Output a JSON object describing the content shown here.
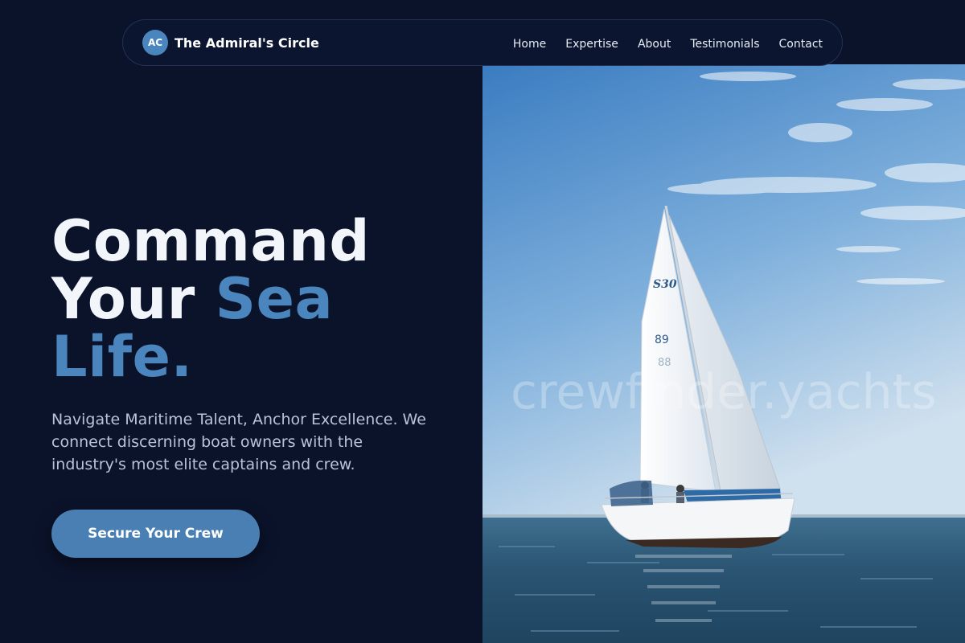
{
  "brand": {
    "initials": "AC",
    "name": "The Admiral's Circle"
  },
  "nav": {
    "items": [
      {
        "label": "Home"
      },
      {
        "label": "Expertise"
      },
      {
        "label": "About"
      },
      {
        "label": "Testimonials"
      },
      {
        "label": "Contact"
      }
    ]
  },
  "hero": {
    "headline_line1": "Command",
    "headline_line2_plain": "Your ",
    "headline_line2_accent": "Sea",
    "headline_line3_accent": "Life.",
    "subtext": "Navigate Maritime Talent, Anchor Excellence. We connect discerning boat owners with the industry's most elite captains and crew.",
    "cta_label": "Secure Your Crew"
  },
  "image": {
    "watermark": "crewfinder.yachts",
    "sail_text": "S30",
    "sail_number_1": "89",
    "sail_number_2": "88"
  },
  "colors": {
    "background": "#0b132b",
    "accent": "#4a86bd",
    "button": "#4a7fb4"
  }
}
